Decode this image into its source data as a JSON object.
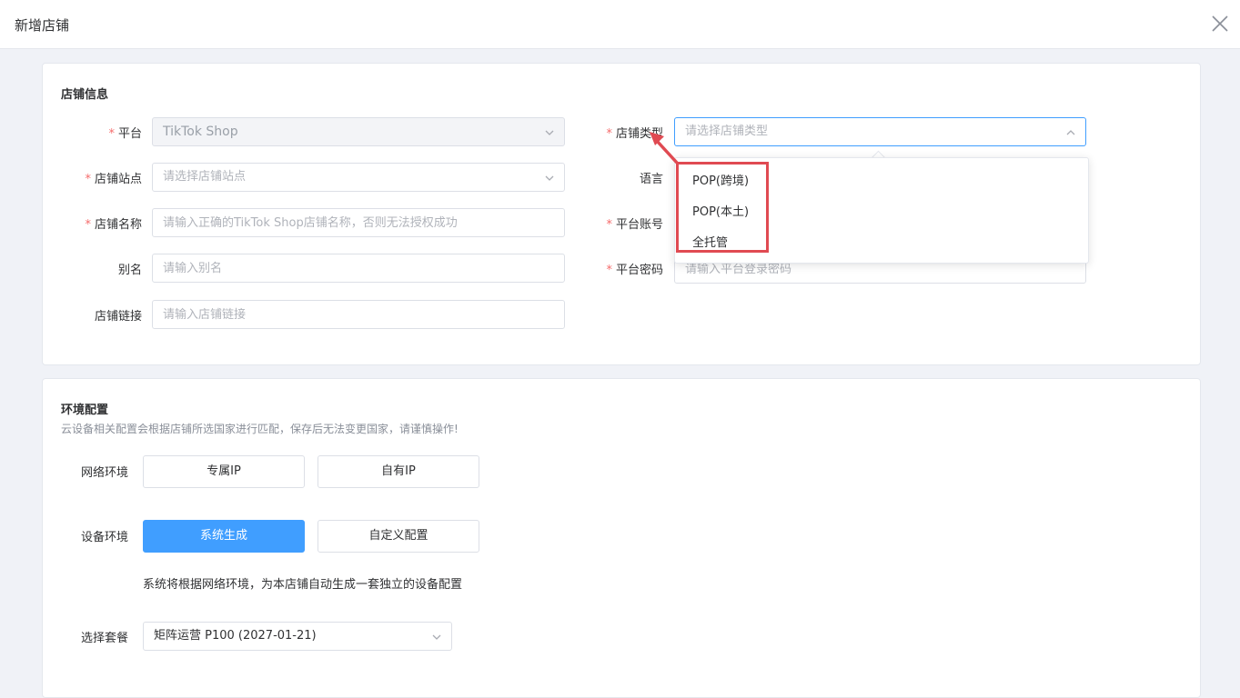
{
  "dialog": {
    "title": "新增店铺"
  },
  "shop_info": {
    "section_title": "店铺信息",
    "platform": {
      "label": "平台",
      "value": "TikTok Shop"
    },
    "shop_type": {
      "label": "店铺类型",
      "placeholder": "请选择店铺类型",
      "options": [
        "POP(跨境)",
        "POP(本土)",
        "全托管"
      ]
    },
    "site": {
      "label": "店铺站点",
      "placeholder": "请选择店铺站点"
    },
    "language": {
      "label": "语言"
    },
    "shop_name": {
      "label": "店铺名称",
      "placeholder": "请输入正确的TikTok Shop店铺名称，否则无法授权成功"
    },
    "platform_account": {
      "label": "平台账号"
    },
    "alias": {
      "label": "别名",
      "placeholder": "请输入别名"
    },
    "platform_password": {
      "label": "平台密码",
      "placeholder": "请输入平台登录密码"
    },
    "shop_link": {
      "label": "店铺链接",
      "placeholder": "请输入店铺链接"
    }
  },
  "env_config": {
    "section_title": "环境配置",
    "subtitle": "云设备相关配置会根据店铺所选国家进行匹配，保存后无法变更国家，请谨慎操作!",
    "network": {
      "label": "网络环境",
      "options": [
        "专属IP",
        "自有IP"
      ]
    },
    "device": {
      "label": "设备环境",
      "options": [
        "系统生成",
        "自定义配置"
      ],
      "selected": "系统生成"
    },
    "device_hint": "系统将根据网络环境，为本店铺自动生成一套独立的设备配置",
    "plan": {
      "label": "选择套餐",
      "value": "矩阵运营 P100 (2027-01-21)"
    }
  },
  "colors": {
    "primary": "#409eff",
    "required": "#f56c6c",
    "annotation": "#e04a52"
  },
  "icons": {
    "close": "close-icon",
    "arrow": "chevron-down-icon",
    "arrow_up": "chevron-up-icon"
  }
}
